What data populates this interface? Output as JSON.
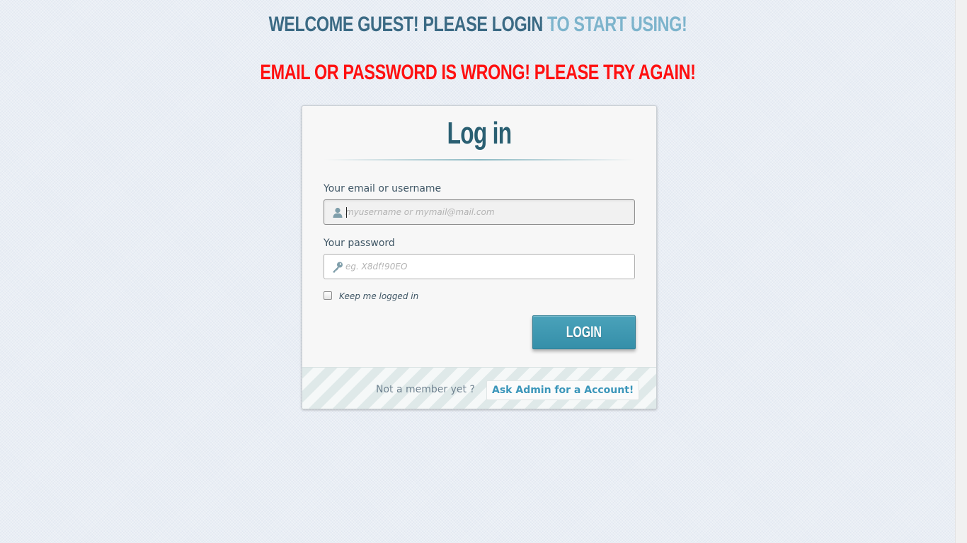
{
  "header": {
    "welcome_main": "Welcome Guest! Please Login",
    "welcome_accent": "to Start Using!",
    "error_message": "Email or password is wrong! Please try again!"
  },
  "login_form": {
    "title": "Log in",
    "email_label": "Your email or username",
    "email_placeholder": "myusername or mymail@mail.com",
    "email_value": "",
    "email_icon": "user-icon",
    "password_label": "Your password",
    "password_placeholder": "eg. X8df!90EO",
    "password_value": "",
    "password_icon": "key-icon",
    "remember_label": "Keep me logged in",
    "remember_checked": false,
    "submit_label": "Login"
  },
  "footer": {
    "prompt": "Not a member yet ?",
    "link_label": "Ask Admin for a Account!"
  },
  "colors": {
    "accent": "#3b96ba",
    "button": "#3a94ae",
    "error": "#ff1010",
    "heading": "#3b6a84",
    "heading_accent": "#7db4cc"
  }
}
